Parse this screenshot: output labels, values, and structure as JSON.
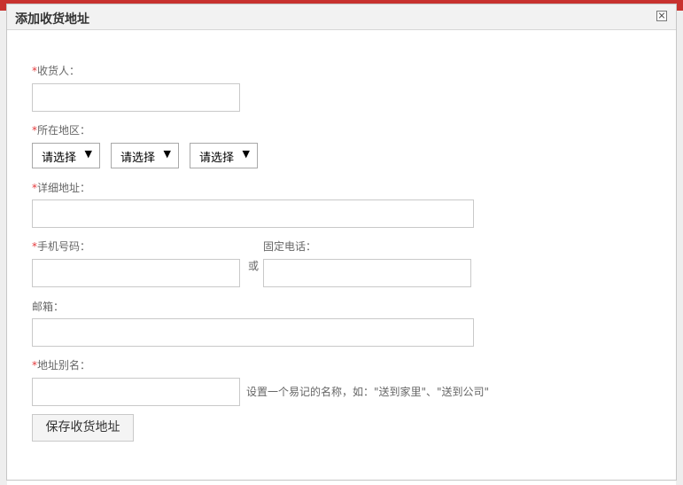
{
  "dialog": {
    "title": "添加收货地址"
  },
  "form": {
    "required_mark": "*",
    "consignee_label": "收货人：",
    "region_label": "所在地区：",
    "region_selects": [
      {
        "value": "请选择"
      },
      {
        "value": "请选择"
      },
      {
        "value": "请选择"
      }
    ],
    "address_label": "详细地址：",
    "mobile_label": "手机号码：",
    "or_text": "或",
    "phone_label": "固定电话：",
    "email_label": "邮箱：",
    "alias_label": "地址别名：",
    "alias_hint": "设置一个易记的名称，如：\"送到家里\"、\"送到公司\"",
    "save_button": "保存收货地址"
  },
  "icons": {
    "close": "close-icon",
    "dropdown": "triangle-down-icon"
  },
  "colors": {
    "required": "#e4393c",
    "header_bg": "#f2f2f2",
    "backdrop_header": "#c8322f"
  }
}
